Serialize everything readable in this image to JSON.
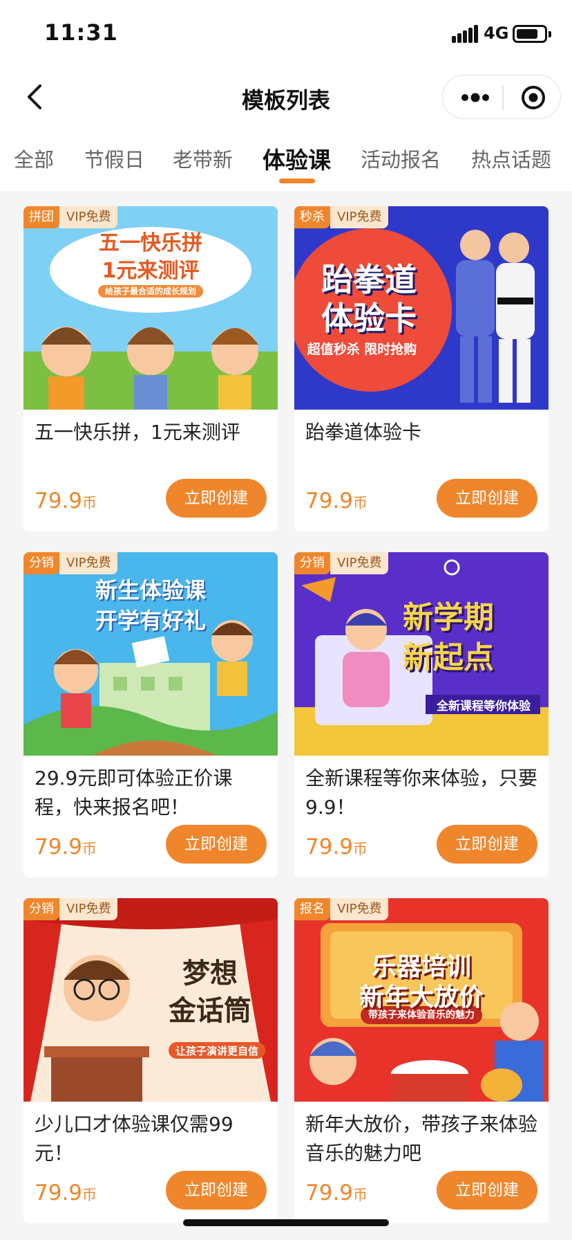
{
  "status_bar": {
    "time": "11:31",
    "network": "4G"
  },
  "navbar": {
    "title": "模板列表"
  },
  "tabs": [
    {
      "label": "全部",
      "active": false
    },
    {
      "label": "节假日",
      "active": false
    },
    {
      "label": "老带新",
      "active": false
    },
    {
      "label": "体验课",
      "active": true
    },
    {
      "label": "活动报名",
      "active": false
    },
    {
      "label": "热点话题",
      "active": false
    }
  ],
  "accent_color": "#f0862b",
  "cards": [
    {
      "tag_type": "拼团",
      "tag_vip": "VIP免费",
      "banner": {
        "line1": "五一快乐拼",
        "line2": "1元来测评",
        "sub": "给孩子最合适的成长规划"
      },
      "title": "五一快乐拼，1元来测评",
      "price": "79.9",
      "unit": "币",
      "button": "立即创建"
    },
    {
      "tag_type": "秒杀",
      "tag_vip": "VIP免费",
      "banner": {
        "line1": "跆拳道",
        "line2": "体验卡",
        "sub": "超值秒杀  限时抢购"
      },
      "title": "跆拳道体验卡",
      "price": "79.9",
      "unit": "币",
      "button": "立即创建"
    },
    {
      "tag_type": "分销",
      "tag_vip": "VIP免费",
      "banner": {
        "line1": "新生体验课",
        "line2": "开学有好礼",
        "sub": ""
      },
      "title": "29.9元即可体验正价课程，快来报名吧！",
      "price": "79.9",
      "unit": "币",
      "button": "立即创建"
    },
    {
      "tag_type": "分销",
      "tag_vip": "VIP免费",
      "banner": {
        "line1": "新学期",
        "line2": "新起点",
        "sub": "全新课程等你体验"
      },
      "title": "全新课程等你来体验，只要9.9！",
      "price": "79.9",
      "unit": "币",
      "button": "立即创建"
    },
    {
      "tag_type": "分销",
      "tag_vip": "VIP免费",
      "banner": {
        "line1": "梦想",
        "line2": "金话筒",
        "sub": "让孩子演讲更自信"
      },
      "title": "少儿口才体验课仅需99元！",
      "price": "79.9",
      "unit": "币",
      "button": "立即创建"
    },
    {
      "tag_type": "报名",
      "tag_vip": "VIP免费",
      "banner": {
        "line1": "乐器培训",
        "line2": "新年大放价",
        "sub": "带孩子来体验音乐的魅力"
      },
      "title": "新年大放价，带孩子来体验音乐的魅力吧",
      "price": "79.9",
      "unit": "币",
      "button": "立即创建"
    }
  ]
}
